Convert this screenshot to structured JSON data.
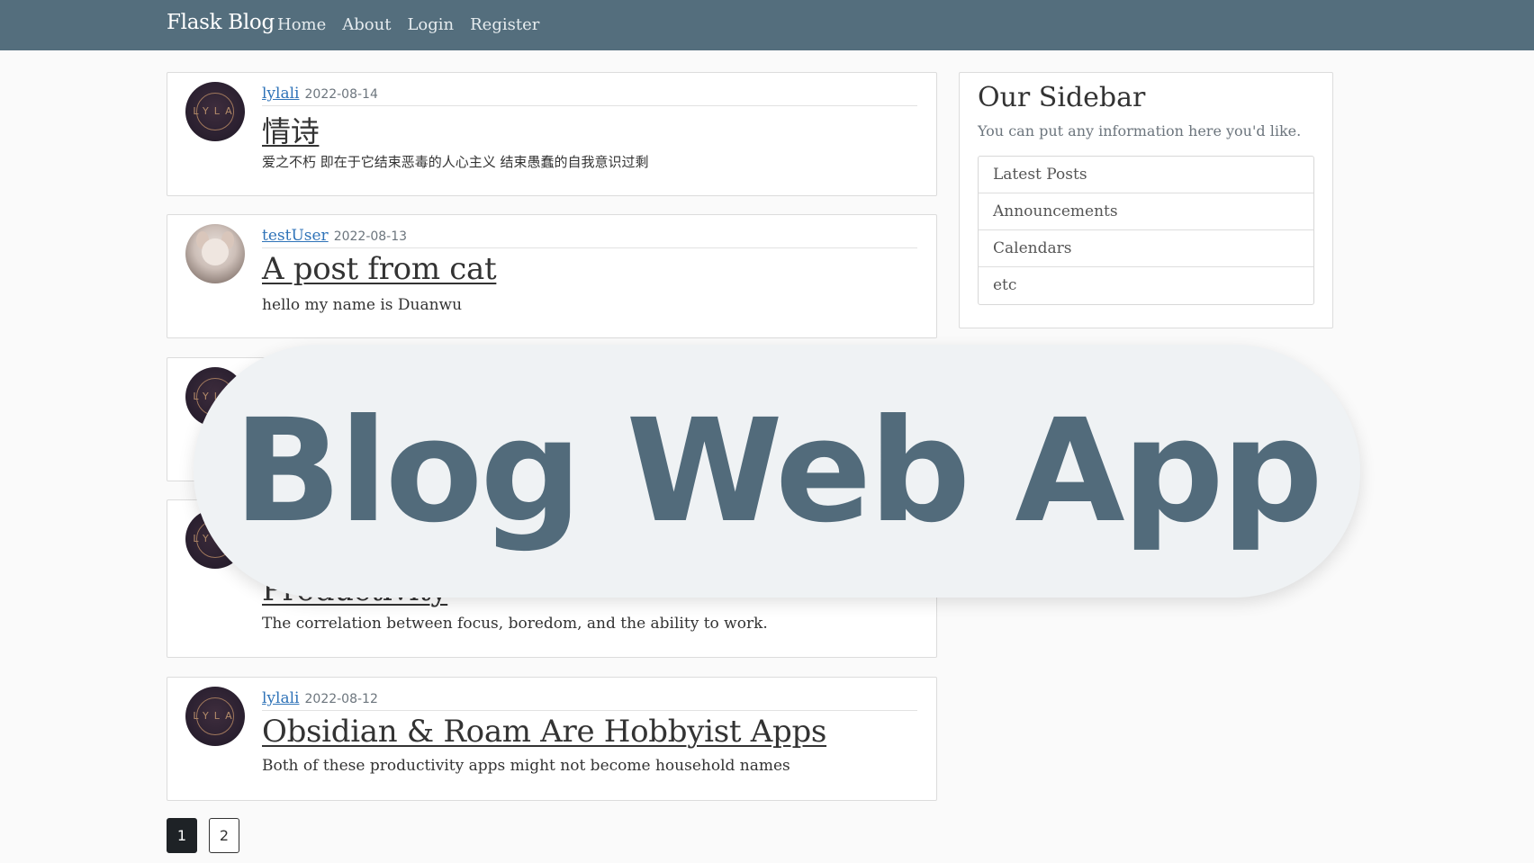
{
  "navbar": {
    "brand": "Flask Blog",
    "links": [
      "Home",
      "About",
      "Login",
      "Register"
    ]
  },
  "posts": [
    {
      "author": "lylali",
      "date": "2022-08-14",
      "title": "情诗",
      "content": "爱之不朽 即在于它结束恶毒的人心主义 结束愚蠢的自我意识过剩",
      "avatar": "monogram-avatar"
    },
    {
      "author": "testUser",
      "date": "2022-08-13",
      "title": "A post from cat",
      "content": "hello my name is Duanwu",
      "avatar": "cat-avatar"
    },
    {
      "author": "",
      "date": "",
      "title": "",
      "content": "",
      "avatar": "monogram-avatar"
    },
    {
      "author": "",
      "date": "",
      "title": "Productivity",
      "content": "The correlation between focus, boredom, and the ability to work.",
      "avatar": "monogram-avatar"
    },
    {
      "author": "lylali",
      "date": "2022-08-12",
      "title": "Obsidian & Roam Are Hobbyist Apps",
      "content": "Both of these productivity apps might not become household names",
      "avatar": "monogram-avatar"
    }
  ],
  "sidebar": {
    "title": "Our Sidebar",
    "text": "You can put any information here you'd like.",
    "items": [
      "Latest Posts",
      "Announcements",
      "Calendars",
      "etc"
    ]
  },
  "pagination": {
    "pages": [
      "1",
      "2"
    ],
    "current": "1"
  },
  "overlay": {
    "text": "Blog Web App"
  },
  "colors": {
    "navbar": "#546e7d",
    "link": "#2f73b8",
    "overlay_text": "#526b7b"
  }
}
